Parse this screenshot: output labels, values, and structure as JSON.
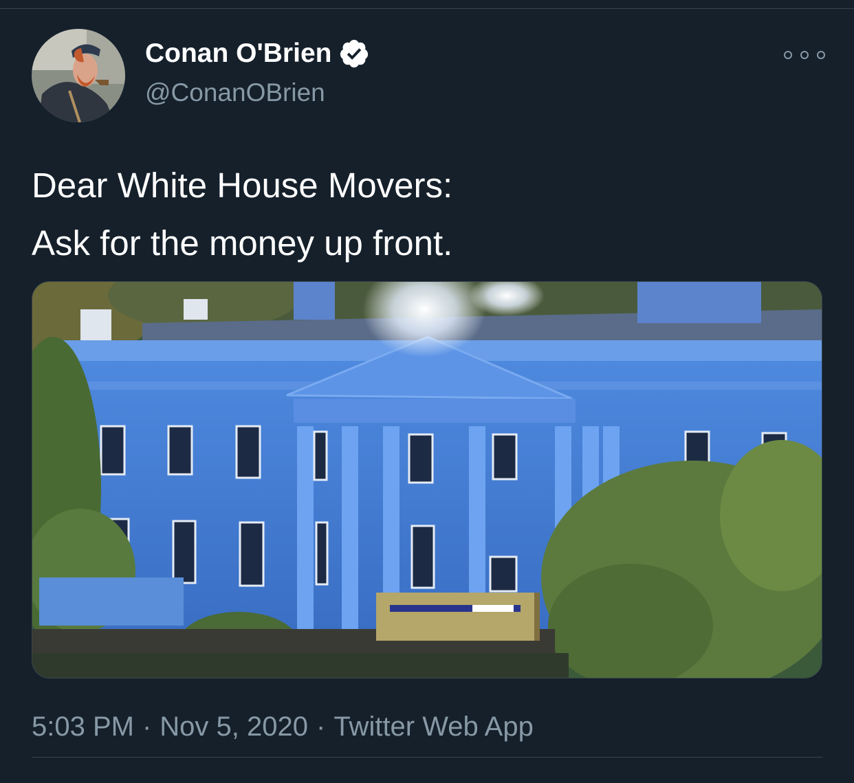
{
  "author": {
    "display_name": "Conan O'Brien",
    "handle": "@ConanOBrien",
    "verified": true
  },
  "tweet": {
    "lines": [
      "Dear White House Movers:",
      "Ask for the money up front."
    ]
  },
  "meta": {
    "time": "5:03 PM",
    "separator": "·",
    "date": "Nov 5, 2020",
    "source": "Twitter Web App"
  },
  "icons": {
    "verified": "verified-badge-icon",
    "more": "more-options-icon"
  },
  "colors": {
    "background": "#15202b",
    "secondary_text": "#8899a6",
    "verified_badge": "#ffffff",
    "divider": "#38444d"
  }
}
